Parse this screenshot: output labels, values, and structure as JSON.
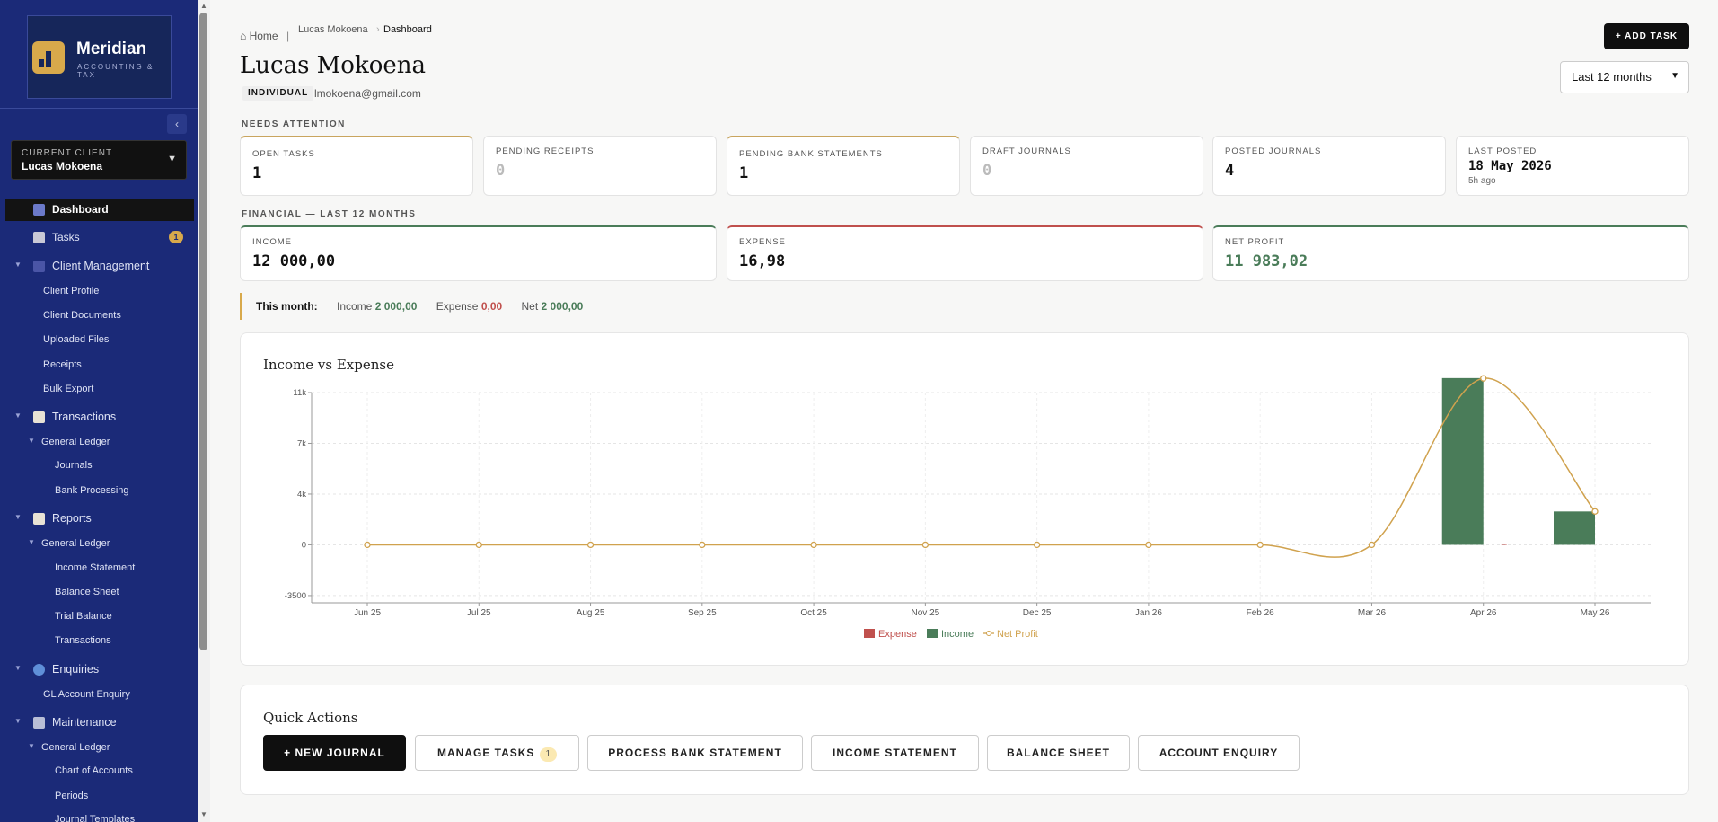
{
  "brand": {
    "name": "Meridian",
    "tagline": "ACCOUNTING & TAX"
  },
  "client_selector": {
    "caption": "CURRENT CLIENT",
    "value": "Lucas Mokoena"
  },
  "sidebar": {
    "collapse": "‹",
    "items": [
      {
        "label": "Dashboard"
      },
      {
        "label": "Tasks",
        "badge": "1"
      },
      {
        "label": "Client Management"
      },
      {
        "label": "Client Profile"
      },
      {
        "label": "Client Documents"
      },
      {
        "label": "Uploaded Files"
      },
      {
        "label": "Receipts"
      },
      {
        "label": "Bulk Export"
      },
      {
        "label": "Transactions"
      },
      {
        "label": "General Ledger"
      },
      {
        "label": "Journals"
      },
      {
        "label": "Bank Processing"
      },
      {
        "label": "Reports"
      },
      {
        "label": "General Ledger"
      },
      {
        "label": "Income Statement"
      },
      {
        "label": "Balance Sheet"
      },
      {
        "label": "Trial Balance"
      },
      {
        "label": "Transactions"
      },
      {
        "label": "Enquiries"
      },
      {
        "label": "GL Account Enquiry"
      },
      {
        "label": "Maintenance"
      },
      {
        "label": "General Ledger"
      },
      {
        "label": "Chart of Accounts"
      },
      {
        "label": "Periods"
      },
      {
        "label": "Journal Templates"
      }
    ]
  },
  "breadcrumb": {
    "home": "⌂ Home",
    "sep": "|",
    "client": "Lucas Mokoena",
    "arrow": "›",
    "current": "Dashboard"
  },
  "header": {
    "title": "Lucas Mokoena",
    "tag": "INDIVIDUAL",
    "email": "lmokoena@gmail.com",
    "add_task": "+ ADD TASK",
    "period": "Last 12 months"
  },
  "attention": {
    "label": "NEEDS ATTENTION",
    "cards": [
      {
        "caption": "OPEN TASKS",
        "value": "1"
      },
      {
        "caption": "PENDING RECEIPTS",
        "value": "0"
      },
      {
        "caption": "PENDING BANK STATEMENTS",
        "value": "1"
      },
      {
        "caption": "DRAFT JOURNALS",
        "value": "0"
      },
      {
        "caption": "POSTED JOURNALS",
        "value": "4"
      },
      {
        "caption": "LAST POSTED",
        "value": "18 May 2026",
        "sub": "5h ago"
      }
    ]
  },
  "financial": {
    "label": "FINANCIAL — LAST 12 MONTHS",
    "cards": [
      {
        "caption": "INCOME",
        "value": "12 000,00"
      },
      {
        "caption": "EXPENSE",
        "value": "16,98"
      },
      {
        "caption": "NET PROFIT",
        "value": "11 983,02"
      }
    ]
  },
  "this_month": {
    "label": "This month:",
    "income_label": "Income",
    "income": "2 000,00",
    "expense_label": "Expense",
    "expense": "0,00",
    "net_label": "Net",
    "net": "2 000,00"
  },
  "colors": {
    "income": "#4a7c59",
    "expense": "#c0504d",
    "net": "#d0a24e",
    "accent": "#d8a94b"
  },
  "chart_data": {
    "type": "bar",
    "title": "Income vs Expense",
    "categories": [
      "Jun 25",
      "Jul 25",
      "Aug 25",
      "Sep 25",
      "Oct 25",
      "Nov 25",
      "Dec 25",
      "Jan 26",
      "Feb 26",
      "Mar 26",
      "Apr 26",
      "May 26"
    ],
    "series": [
      {
        "name": "Expense",
        "type": "bar",
        "values": [
          0,
          0,
          0,
          0,
          0,
          0,
          0,
          0,
          0,
          0,
          16.98,
          0
        ]
      },
      {
        "name": "Income",
        "type": "bar",
        "values": [
          0,
          0,
          0,
          0,
          0,
          0,
          0,
          0,
          0,
          0,
          10000,
          2000
        ]
      },
      {
        "name": "Net Profit",
        "type": "line",
        "values": [
          0,
          0,
          0,
          0,
          0,
          0,
          0,
          0,
          0,
          0,
          9983.02,
          2000
        ]
      }
    ],
    "ylim": [
      -3500,
      11000
    ],
    "yticks": [
      {
        "value": 11000,
        "label": "11k"
      },
      {
        "value": 7500,
        "label": "7k"
      },
      {
        "value": 4000,
        "label": "4k"
      },
      {
        "value": 500,
        "label": "0"
      },
      {
        "value": -3000,
        "label": "-3500"
      }
    ],
    "grid": true,
    "legend": "bottom-center"
  },
  "quick_actions": {
    "title": "Quick Actions",
    "buttons": [
      {
        "label": "+ NEW JOURNAL"
      },
      {
        "label": "MANAGE TASKS",
        "badge": "1"
      },
      {
        "label": "PROCESS BANK STATEMENT"
      },
      {
        "label": "INCOME STATEMENT"
      },
      {
        "label": "BALANCE SHEET"
      },
      {
        "label": "ACCOUNT ENQUIRY"
      }
    ]
  }
}
